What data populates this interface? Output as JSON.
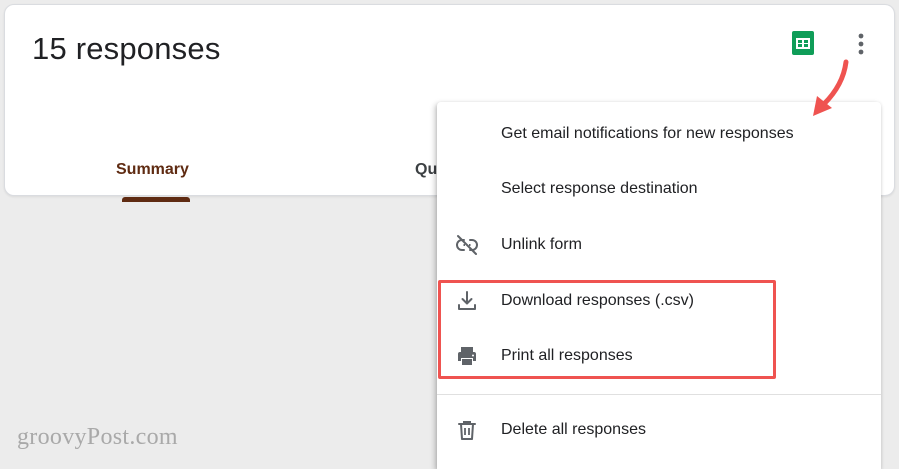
{
  "header": {
    "title": "15 responses",
    "sheets_icon": "google-sheets-icon",
    "more_icon": "more-vert-icon"
  },
  "tabs": [
    {
      "label": "Summary",
      "selected": true
    },
    {
      "label": "Qu",
      "selected": false
    }
  ],
  "menu": {
    "items": [
      {
        "label": "Get email notifications for new responses",
        "icon": ""
      },
      {
        "label": "Select response destination",
        "icon": ""
      },
      {
        "label": "Unlink form",
        "icon": "link-off-icon"
      },
      {
        "label": "Download responses (.csv)",
        "icon": "download-icon"
      },
      {
        "label": "Print all responses",
        "icon": "print-icon"
      },
      {
        "label": "Delete all responses",
        "icon": "trash-icon"
      }
    ]
  },
  "watermark": "groovyPost.com",
  "colors": {
    "accent": "#5f2b12",
    "sheets_green": "#0f9d58",
    "annotation_red": "#ef5350",
    "text": "#202124",
    "icon_gray": "#5f6368"
  }
}
